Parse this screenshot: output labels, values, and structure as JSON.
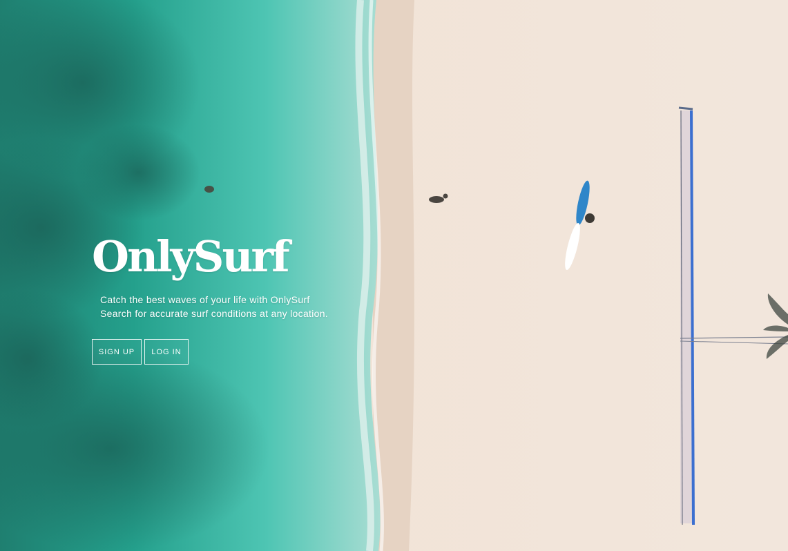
{
  "hero": {
    "title": "OnlySurf",
    "tagline_line1": "Catch the best waves of your life with OnlySurf",
    "tagline_line2": "Search for accurate surf conditions at any location.",
    "buttons": {
      "signup_label": "SIGN UP",
      "login_label": "LOG IN"
    }
  },
  "colors": {
    "ocean_deep": "#1f8c7a",
    "ocean_shallow": "#3fc2ac",
    "sand": "#efe2d6",
    "surfboard_blue": "#2f86c9",
    "text": "#ffffff"
  },
  "icons": [
    "surfboard-icon",
    "volleyball-net-icon",
    "palm-tree-icon"
  ]
}
